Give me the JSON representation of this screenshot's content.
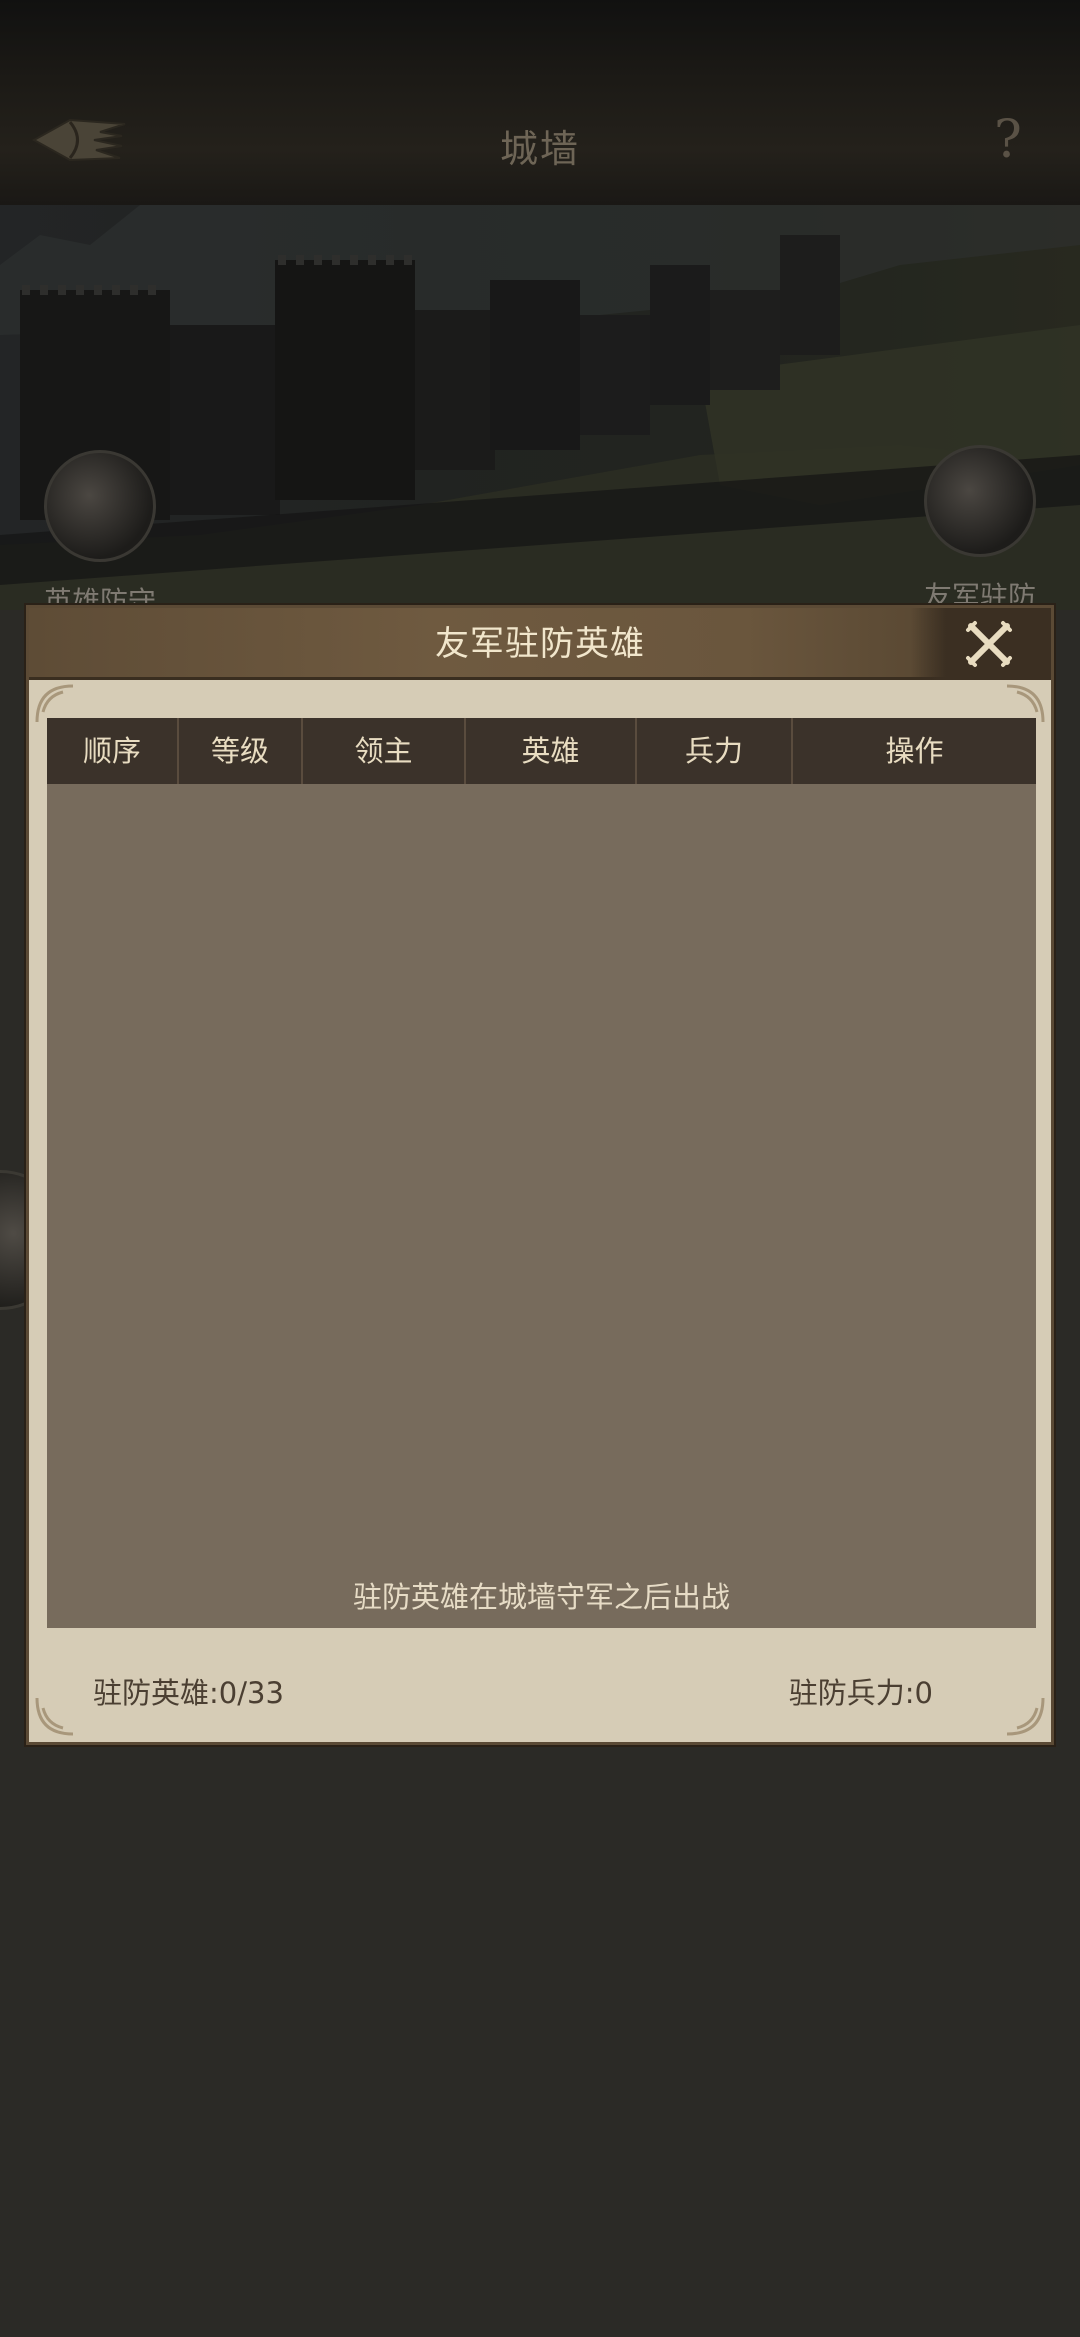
{
  "topbar": {
    "title": "城墙",
    "help_label": "?"
  },
  "scene": {
    "hero_defense_label": "英雄防守",
    "ally_garrison_label": "友军驻防"
  },
  "dialog": {
    "title": "友军驻防英雄",
    "columns": [
      "顺序",
      "等级",
      "领主",
      "英雄",
      "兵力",
      "操作"
    ],
    "empty_hint": "驻防英雄在城墙守军之后出战",
    "garrison_heroes": "驻防英雄:0/33",
    "garrison_troops": "驻防兵力:0"
  },
  "colors": {
    "background": "#2b2a26",
    "dialog_bg": "#d6ccb6",
    "panel_bg": "#776b5c",
    "header_bg": "#3b322a",
    "close_icon": "#e8dcc0"
  },
  "icons": {
    "back": "winged-arrow-back-icon",
    "help": "question-mark-icon",
    "close": "crossed-x-icon"
  }
}
